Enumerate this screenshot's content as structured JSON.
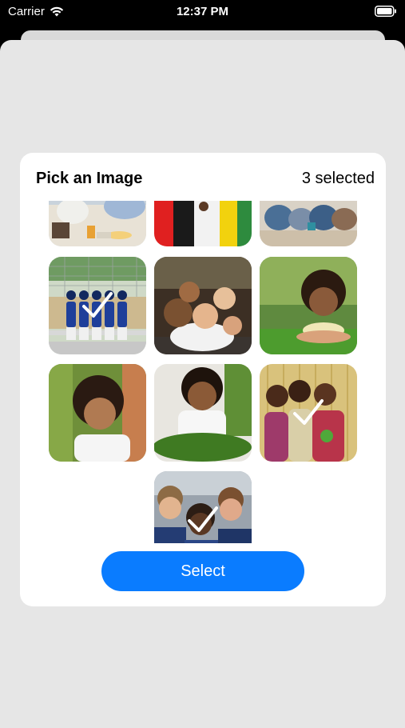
{
  "status_bar": {
    "carrier": "Carrier",
    "time": "12:37 PM"
  },
  "picker": {
    "title": "Pick an Image",
    "selected_count": "3 selected",
    "select_label": "Select"
  },
  "photos": [
    {
      "name": "photo-family-dinner",
      "selected": false
    },
    {
      "name": "photo-group-colorful",
      "selected": false
    },
    {
      "name": "photo-group-sitting",
      "selected": false
    },
    {
      "name": "photo-baseball-team",
      "selected": true
    },
    {
      "name": "photo-family-portrait",
      "selected": false
    },
    {
      "name": "photo-girl-on-grass",
      "selected": false
    },
    {
      "name": "photo-child-in-leaves",
      "selected": false
    },
    {
      "name": "photo-girl-with-leaf",
      "selected": false
    },
    {
      "name": "photo-three-women",
      "selected": true
    },
    {
      "name": "photo-three-boys",
      "selected": true
    }
  ],
  "icons": {
    "wifi": "wifi-icon",
    "battery": "battery-icon",
    "check": "checkmark-icon"
  },
  "colors": {
    "accent": "#0a7cff",
    "background": "#e6e6e6",
    "card": "#ffffff"
  }
}
